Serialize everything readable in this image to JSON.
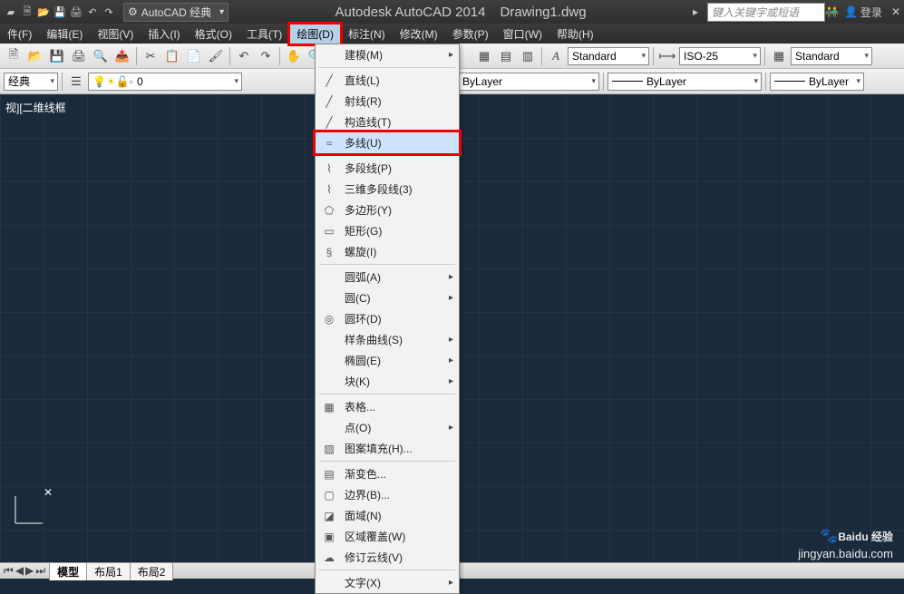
{
  "title": {
    "workspace": "AutoCAD 经典",
    "app": "Autodesk AutoCAD 2014",
    "doc": "Drawing1.dwg",
    "search_placeholder": "键入关键字或短语",
    "login": "登录"
  },
  "menubar": [
    "件(F)",
    "编辑(E)",
    "视图(V)",
    "插入(I)",
    "格式(O)",
    "工具(T)",
    "绘图(D)",
    "标注(N)",
    "修改(M)",
    "参数(P)",
    "窗口(W)",
    "帮助(H)"
  ],
  "menubar_active_index": 6,
  "toolbar2": {
    "text_style": "Standard",
    "dim_style": "ISO-25",
    "table_style": "Standard"
  },
  "toolbar3": {
    "layer_combo_label": "0",
    "layer_style": "经典",
    "color": "ByLayer",
    "linetype": "ByLayer",
    "lineweight": "ByLayer"
  },
  "dropdown": [
    {
      "label": "建模(M)",
      "sub": true,
      "icon": ""
    },
    {
      "sep": true
    },
    {
      "label": "直线(L)",
      "icon": "╱"
    },
    {
      "label": "射线(R)",
      "icon": "╱"
    },
    {
      "label": "构造线(T)",
      "icon": "╱"
    },
    {
      "label": "多线(U)",
      "icon": "≈",
      "highlight": true
    },
    {
      "sep": true
    },
    {
      "label": "多段线(P)",
      "icon": "⌇"
    },
    {
      "label": "三维多段线(3)",
      "icon": "⌇"
    },
    {
      "label": "多边形(Y)",
      "icon": "⬠"
    },
    {
      "label": "矩形(G)",
      "icon": "▭"
    },
    {
      "label": "螺旋(I)",
      "icon": "§"
    },
    {
      "sep": true
    },
    {
      "label": "圆弧(A)",
      "sub": true,
      "icon": ""
    },
    {
      "label": "圆(C)",
      "sub": true,
      "icon": ""
    },
    {
      "label": "圆环(D)",
      "icon": "◎"
    },
    {
      "label": "样条曲线(S)",
      "sub": true,
      "icon": ""
    },
    {
      "label": "椭圆(E)",
      "sub": true,
      "icon": ""
    },
    {
      "label": "块(K)",
      "sub": true,
      "icon": ""
    },
    {
      "sep": true
    },
    {
      "label": "表格...",
      "icon": "▦"
    },
    {
      "label": "点(O)",
      "sub": true,
      "icon": ""
    },
    {
      "label": "图案填充(H)...",
      "icon": "▨"
    },
    {
      "sep": true
    },
    {
      "label": "渐变色...",
      "icon": "▤"
    },
    {
      "label": "边界(B)...",
      "icon": "▢"
    },
    {
      "label": "面域(N)",
      "icon": "◪"
    },
    {
      "label": "区域覆盖(W)",
      "icon": "▣"
    },
    {
      "label": "修订云线(V)",
      "icon": "☁"
    },
    {
      "sep": true
    },
    {
      "label": "文字(X)",
      "sub": true,
      "icon": ""
    }
  ],
  "canvas": {
    "topleft": "视][二维线框"
  },
  "tabs": {
    "active": "模型",
    "others": [
      "布局1",
      "布局2"
    ]
  },
  "watermark": {
    "brand": "Baidu 经验",
    "url": "jingyan.baidu.com"
  }
}
